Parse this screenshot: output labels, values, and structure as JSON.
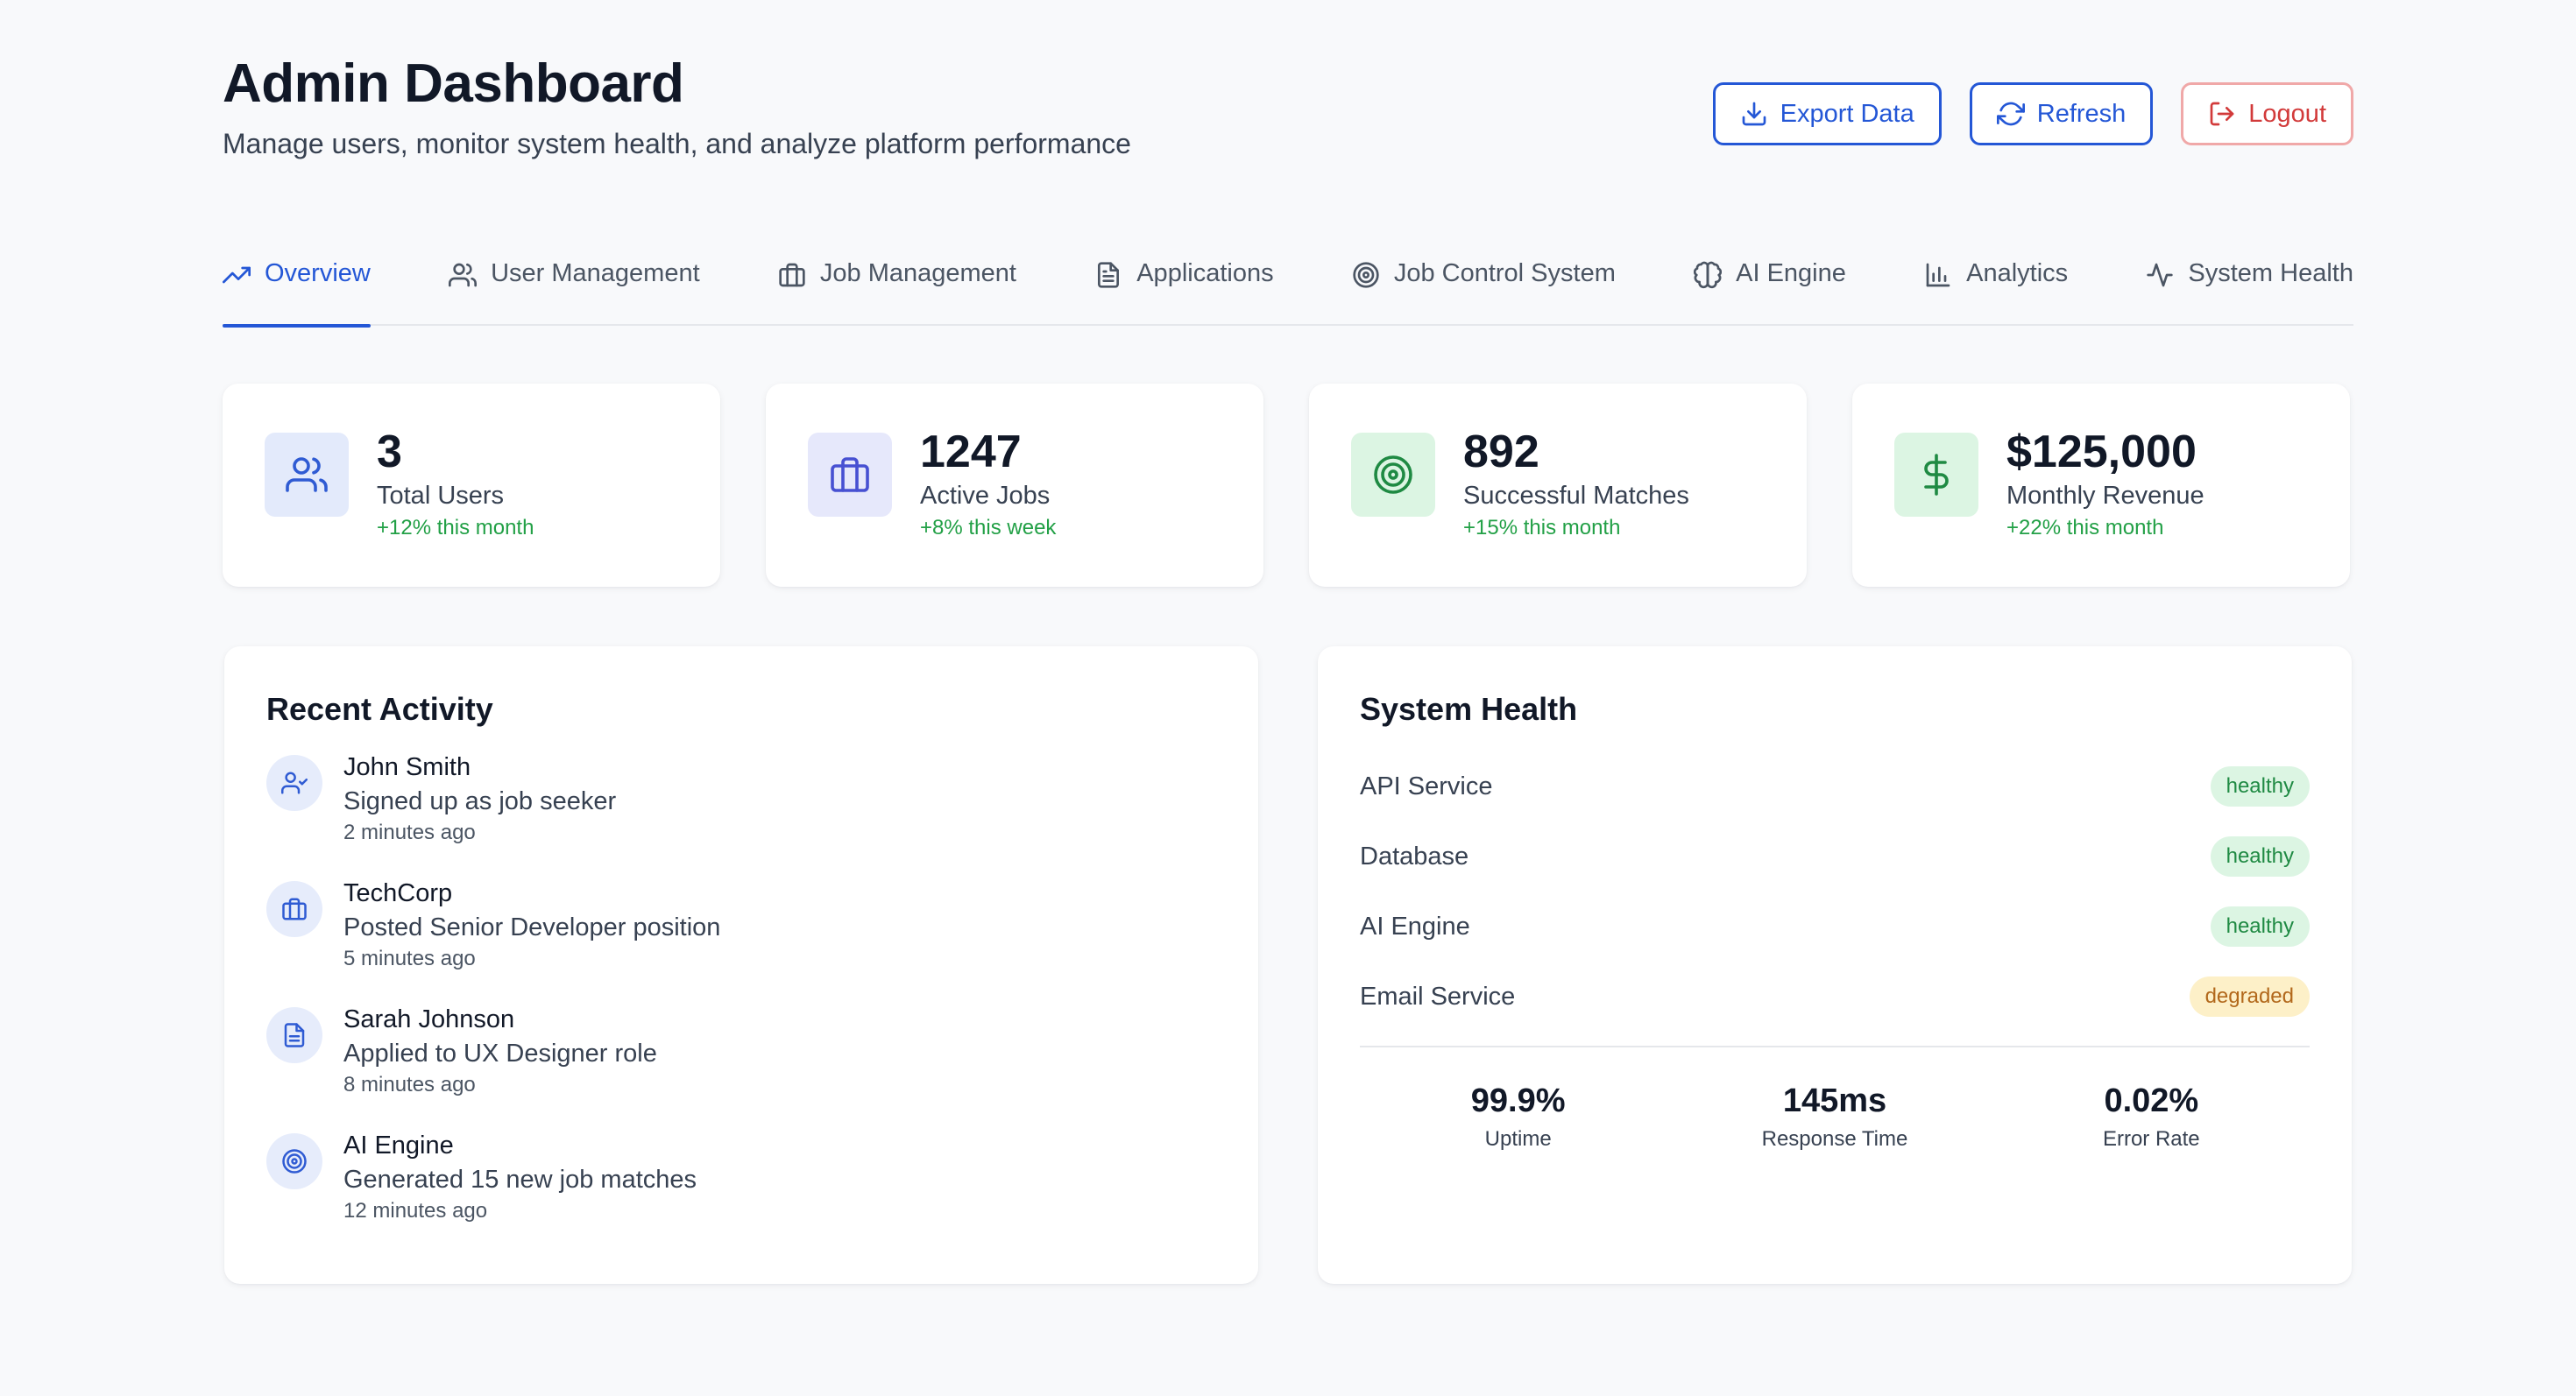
{
  "header": {
    "title": "Admin Dashboard",
    "subtitle": "Manage users, monitor system health, and analyze platform performance",
    "actions": {
      "export_label": "Export Data",
      "refresh_label": "Refresh",
      "logout_label": "Logout"
    }
  },
  "tabs": [
    {
      "label": "Overview",
      "icon": "trending-up-icon",
      "active": true
    },
    {
      "label": "User Management",
      "icon": "users-icon"
    },
    {
      "label": "Job Management",
      "icon": "briefcase-icon"
    },
    {
      "label": "Applications",
      "icon": "file-text-icon"
    },
    {
      "label": "Job Control System",
      "icon": "target-icon"
    },
    {
      "label": "AI Engine",
      "icon": "brain-icon"
    },
    {
      "label": "Analytics",
      "icon": "bar-chart-icon"
    },
    {
      "label": "System Health",
      "icon": "activity-icon"
    }
  ],
  "stats": [
    {
      "value": "3",
      "label": "Total Users",
      "change": "+12% this month",
      "icon": "users-icon"
    },
    {
      "value": "1247",
      "label": "Active Jobs",
      "change": "+8% this week",
      "icon": "briefcase-icon"
    },
    {
      "value": "892",
      "label": "Successful Matches",
      "change": "+15% this month",
      "icon": "target-icon"
    },
    {
      "value": "$125,000",
      "label": "Monthly Revenue",
      "change": "+22% this month",
      "icon": "dollar-icon"
    }
  ],
  "recent_activity": {
    "title": "Recent Activity",
    "items": [
      {
        "name": "John Smith",
        "description": "Signed up as job seeker",
        "time": "2 minutes ago",
        "icon": "user-check-icon"
      },
      {
        "name": "TechCorp",
        "description": "Posted Senior Developer position",
        "time": "5 minutes ago",
        "icon": "briefcase-icon"
      },
      {
        "name": "Sarah Johnson",
        "description": "Applied to UX Designer role",
        "time": "8 minutes ago",
        "icon": "file-text-icon"
      },
      {
        "name": "AI Engine",
        "description": "Generated 15 new job matches",
        "time": "12 minutes ago",
        "icon": "target-icon"
      }
    ]
  },
  "system_health": {
    "title": "System Health",
    "services": [
      {
        "name": "API Service",
        "status": "healthy"
      },
      {
        "name": "Database",
        "status": "healthy"
      },
      {
        "name": "AI Engine",
        "status": "healthy"
      },
      {
        "name": "Email Service",
        "status": "degraded"
      }
    ],
    "metrics": [
      {
        "value": "99.9%",
        "label": "Uptime"
      },
      {
        "value": "145ms",
        "label": "Response Time"
      },
      {
        "value": "0.02%",
        "label": "Error Rate"
      }
    ]
  },
  "colors": {
    "accent": "#2457d6",
    "danger": "#d23a3a",
    "success": "#22a046",
    "healthy_bg": "#dcf5e3",
    "degraded_bg": "#fdf0c8"
  }
}
